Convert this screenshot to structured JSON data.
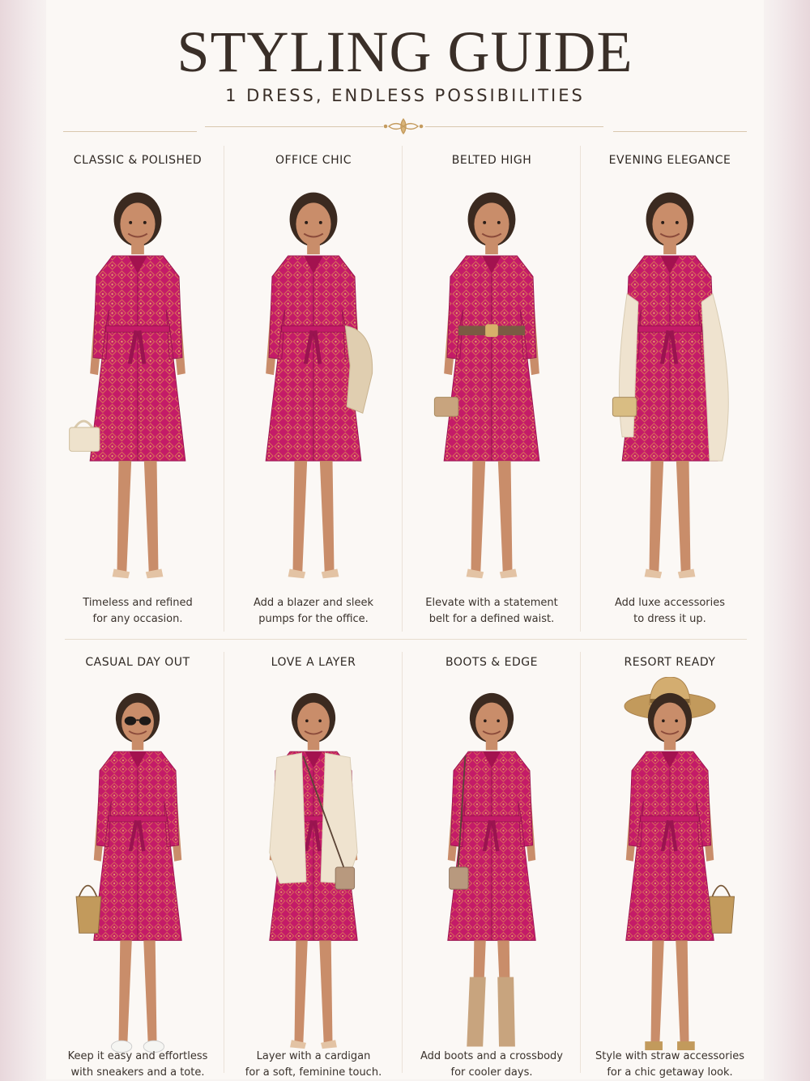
{
  "header": {
    "title": "STYLING GUIDE",
    "subtitle": "1 DRESS, ENDLESS POSSIBILITIES"
  },
  "colors": {
    "dress": "#c41b68",
    "dress_pattern": "#e6a04f",
    "skin": "#c98d6a",
    "hair": "#3b2a20",
    "cream": "#efe3cf",
    "tan": "#c8a47e",
    "brown": "#7a5a43",
    "straw": "#c29a5c"
  },
  "looks": [
    {
      "title": "CLASSIC & POLISHED",
      "caption_line1": "Timeless and refined",
      "caption_line2": "for any occasion.",
      "accessories": [
        "handbag",
        "nude-pumps"
      ]
    },
    {
      "title": "OFFICE CHIC",
      "caption_line1": "Add a blazer and sleek",
      "caption_line2": "pumps for the office.",
      "accessories": [
        "blazer-over-arm",
        "nude-pumps"
      ]
    },
    {
      "title": "BELTED HIGH",
      "caption_line1": "Elevate with a statement",
      "caption_line2": "belt for a defined waist.",
      "accessories": [
        "belt",
        "clutch",
        "heeled-sandals"
      ]
    },
    {
      "title": "EVENING ELEGANCE",
      "caption_line1": "Add luxe accessories",
      "caption_line2": "to dress it up.",
      "accessories": [
        "wrap-shawl",
        "gold-clutch",
        "heeled-sandals"
      ]
    },
    {
      "title": "CASUAL DAY OUT",
      "caption_line1": "Keep it easy and effortless",
      "caption_line2": "with sneakers and a tote.",
      "accessories": [
        "sunglasses",
        "straw-tote",
        "sneakers"
      ]
    },
    {
      "title": "LOVE A LAYER",
      "caption_line1": "Layer with a cardigan",
      "caption_line2": "for a soft, feminine touch.",
      "accessories": [
        "cardigan",
        "crossbody-bag",
        "flats"
      ]
    },
    {
      "title": "BOOTS & EDGE",
      "caption_line1": "Add boots and a crossbody",
      "caption_line2": "for cooler days.",
      "accessories": [
        "crossbody-bag",
        "knee-boots"
      ]
    },
    {
      "title": "RESORT READY",
      "caption_line1": "Style with straw accessories",
      "caption_line2": "for a chic getaway look.",
      "accessories": [
        "sun-hat",
        "straw-tote",
        "wedge-sandals"
      ]
    }
  ]
}
